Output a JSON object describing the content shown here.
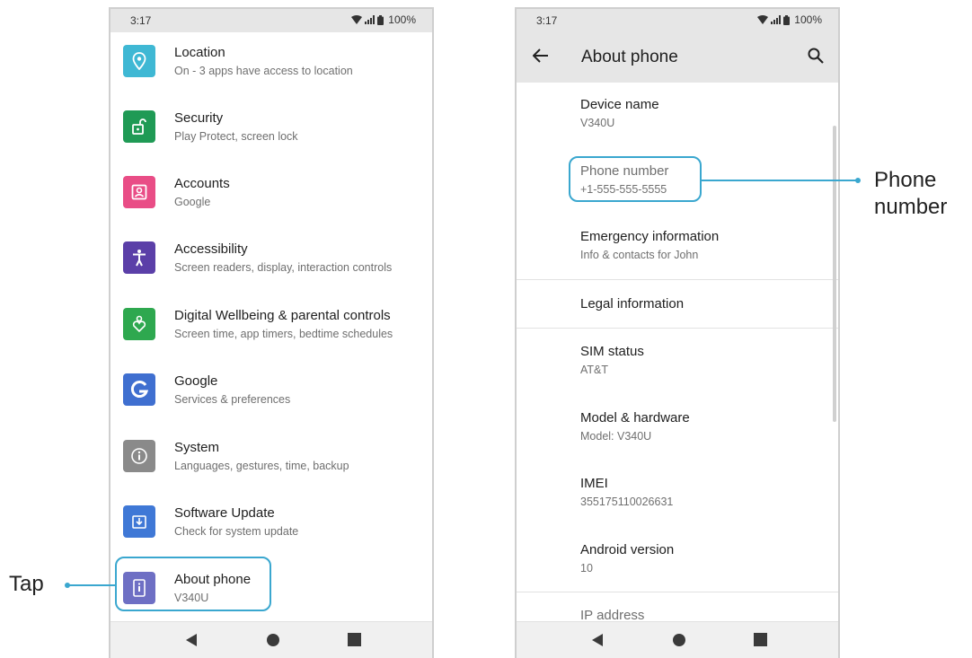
{
  "left_screen": {
    "status": {
      "time": "3:17",
      "battery": "100%"
    },
    "items": [
      {
        "title": "Location",
        "subtitle": "On - 3 apps have access to location",
        "icon": "location-pin-icon",
        "color": "#3fb8d4"
      },
      {
        "title": "Security",
        "subtitle": "Play Protect, screen lock",
        "icon": "lock-icon",
        "color": "#1f9a55"
      },
      {
        "title": "Accounts",
        "subtitle": "Google",
        "icon": "account-box-icon",
        "color": "#e94d86"
      },
      {
        "title": "Accessibility",
        "subtitle": "Screen readers, display, interaction controls",
        "icon": "accessibility-icon",
        "color": "#5b3fa8"
      },
      {
        "title": "Digital Wellbeing & parental controls",
        "subtitle": "Screen time, app timers, bedtime schedules",
        "icon": "wellbeing-heart-icon",
        "color": "#2ea84f"
      },
      {
        "title": "Google",
        "subtitle": "Services & preferences",
        "icon": "google-g-icon",
        "color": "#3f6fd0"
      },
      {
        "title": "System",
        "subtitle": "Languages, gestures, time, backup",
        "icon": "info-circle-icon",
        "color": "#8a8a8a"
      },
      {
        "title": "Software Update",
        "subtitle": "Check for system update",
        "icon": "download-icon",
        "color": "#3f78d6"
      },
      {
        "title": "About phone",
        "subtitle": "V340U",
        "icon": "phone-info-icon",
        "color": "#6e6fc4"
      }
    ]
  },
  "right_screen": {
    "status": {
      "time": "3:17",
      "battery": "100%"
    },
    "title": "About phone",
    "items": [
      {
        "title": "Device name",
        "value": "V340U"
      },
      {
        "title": "Phone number",
        "value": "+1-555-555-5555"
      },
      {
        "title": "Emergency information",
        "value": "Info & contacts for John"
      },
      {
        "title": "Legal information",
        "value": ""
      },
      {
        "title": "SIM status",
        "value": "AT&T"
      },
      {
        "title": "Model & hardware",
        "value": "Model: V340U"
      },
      {
        "title": "IMEI",
        "value": "355175110026631"
      },
      {
        "title": "Android version",
        "value": "10"
      },
      {
        "title": "IP address",
        "value": ""
      }
    ]
  },
  "callouts": {
    "tap": "Tap",
    "phone_number_line1": "Phone",
    "phone_number_line2": "number"
  },
  "colors": {
    "accent": "#3aa7cf"
  }
}
